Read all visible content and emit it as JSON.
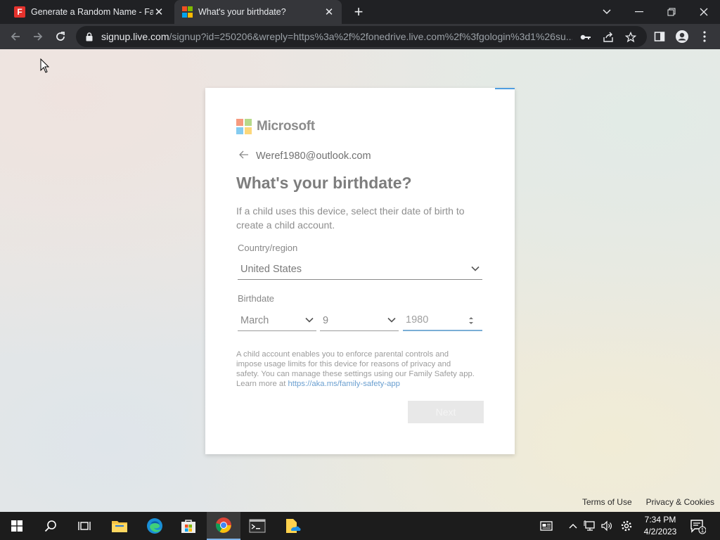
{
  "browser": {
    "tabs": [
      {
        "title": "Generate a Random Name - Fake",
        "active": false,
        "icon": "fakenamegenerator-favicon"
      },
      {
        "title": "What's your birthdate?",
        "active": true,
        "icon": "microsoft-favicon"
      }
    ],
    "newtab_label": "+",
    "url_host": "signup.live.com",
    "url_rest": "/signup?id=250206&wreply=https%3a%2f%2fonedrive.live.com%2f%3fgologin%3d1%26su...",
    "colors": {
      "tab_active": "#35363a",
      "tabstrip": "#202124"
    }
  },
  "signup": {
    "brand": "Microsoft",
    "identity": "Weref1980@outlook.com",
    "heading": "What's your birthdate?",
    "description": "If a child uses this device, select their date of birth to create a child account.",
    "country_label": "Country/region",
    "country_value": "United States",
    "birthdate_label": "Birthdate",
    "month_value": "March",
    "day_value": "9",
    "year_value": "1980",
    "fine_print": "A child account enables you to enforce parental controls and impose usage limits for this device for reasons of privacy and safety. You can manage these settings using our Family Safety app. Learn more at ",
    "fine_print_link": "https://aka.ms/family-safety-app",
    "next_label": "Next",
    "colors": {
      "ms_red": "#f25022",
      "ms_green": "#7fba00",
      "ms_blue": "#00a4ef",
      "ms_yellow": "#ffb900"
    }
  },
  "footer": {
    "terms": "Terms of Use",
    "privacy": "Privacy & Cookies"
  },
  "taskbar": {
    "time": "7:34 PM",
    "date": "4/2/2023",
    "notification_count": "1",
    "pinned": [
      "start-icon",
      "search-icon",
      "task-view-icon",
      "file-explorer-icon",
      "edge-icon",
      "store-icon",
      "chrome-icon",
      "terminal-icon",
      "onedrive-files-icon"
    ]
  }
}
